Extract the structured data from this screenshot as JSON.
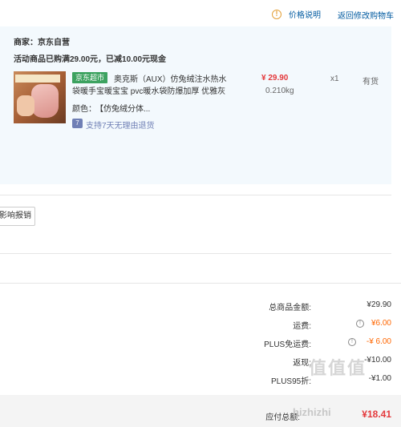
{
  "header": {
    "price_explain": "价格说明",
    "back_to_cart": "返回修改购物车"
  },
  "order": {
    "merchant": "商家：京东自营",
    "promo": "活动商品已购满29.00元，已减10.00元现金",
    "product": {
      "tag": "京东超市",
      "title_line1": "奥克斯（AUX）仿兔绒注水热水",
      "title_line2": "袋暖手宝暖宝宝 pvc暖水袋防爆加厚 优雅灰",
      "color_label": "颜色：",
      "color_value": "【仿兔绒分体...",
      "return_policy": "支持7天无理由退货",
      "price": "¥ 29.90",
      "weight": "0.210kg",
      "qty": "x1",
      "stock": "有货"
    }
  },
  "report_button": "影响报销",
  "summary": [
    {
      "label": "总商品金额:",
      "value": "¥29.90",
      "orange": false,
      "info": false
    },
    {
      "label": "运费:",
      "value": "¥6.00",
      "orange": true,
      "info": true
    },
    {
      "label": "PLUS免运费:",
      "value": "-¥ 6.00",
      "orange": true,
      "info": true
    },
    {
      "label": "返现:",
      "value": "-¥10.00",
      "orange": false,
      "info": false
    },
    {
      "label": "PLUS95折:",
      "value": "-¥1.00",
      "orange": false,
      "info": false
    }
  ],
  "footer": {
    "payable_label": "应付总额:",
    "payable_value": "¥18.41"
  },
  "watermark": {
    "main": "值值值",
    "sub": "hizhizhi"
  }
}
